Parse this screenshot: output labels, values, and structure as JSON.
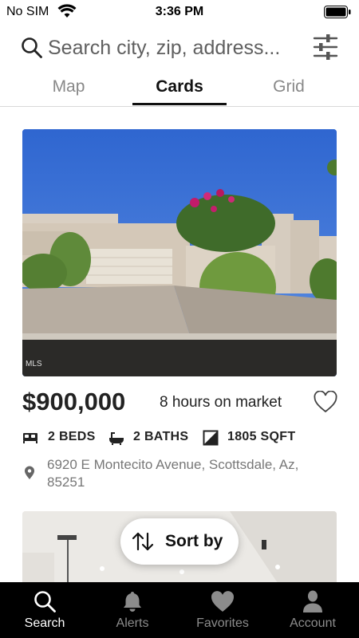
{
  "status_bar": {
    "carrier": "No SIM",
    "time": "3:36 PM"
  },
  "search": {
    "placeholder": "Search city, zip, address..."
  },
  "view_tabs": [
    {
      "label": "Map",
      "active": false
    },
    {
      "label": "Cards",
      "active": true
    },
    {
      "label": "Grid",
      "active": false
    }
  ],
  "listing": {
    "photo_credit": "MLS",
    "price": "$900,000",
    "time_on_market": "8 hours on market",
    "favorited": false,
    "beds": "2 BEDS",
    "baths": "2 BATHS",
    "sqft": "1805 SQFT",
    "address": "6920 E Montecito Avenue, Scottsdale, Az, 85251"
  },
  "sort": {
    "label": "Sort by"
  },
  "tabbar": [
    {
      "label": "Search",
      "icon": "search-icon",
      "active": true
    },
    {
      "label": "Alerts",
      "icon": "bell-icon",
      "active": false
    },
    {
      "label": "Favorites",
      "icon": "heart-icon",
      "active": false
    },
    {
      "label": "Account",
      "icon": "person-icon",
      "active": false
    }
  ],
  "colors": {
    "sky": "#3e72d4",
    "tabbar_bg": "#000000",
    "active_tab": "#111111",
    "inactive_tab": "#888888"
  }
}
